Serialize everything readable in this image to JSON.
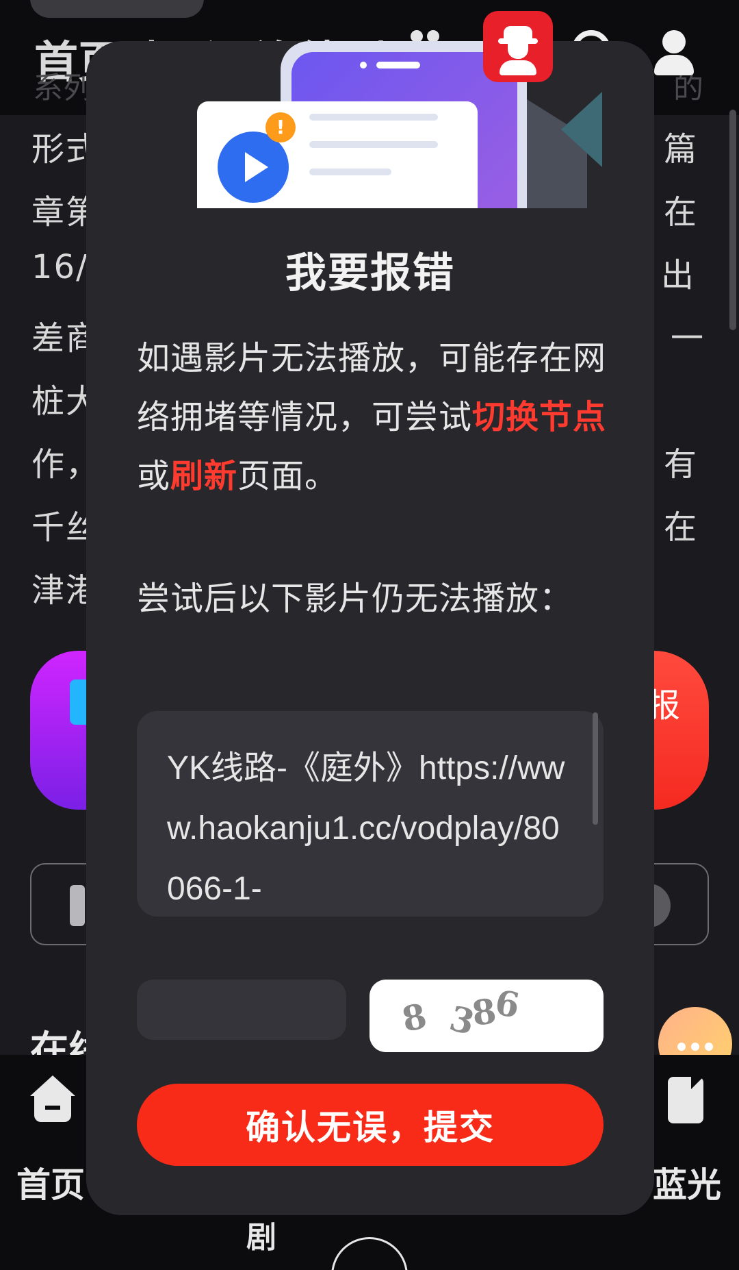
{
  "background": {
    "nav_tabs": [
      "首页",
      "电影",
      "连续剧"
    ],
    "subtitle_left": "系列",
    "subtitle_right": "的",
    "article_lines_left": [
      "形式",
      "章第",
      "16/",
      "差商",
      "桩大",
      "作，",
      "千丝",
      "津港"
    ],
    "article_lines_right": [
      "篇",
      "在",
      "出",
      "一",
      "",
      "有",
      "在",
      ""
    ],
    "red_button_label": "报",
    "section_title": "在线",
    "bottom_nav": {
      "home_label": "首页",
      "series_label": "剧",
      "bluray_label": "蓝光"
    }
  },
  "modal": {
    "alert_mark": "!",
    "title": "我要报错",
    "desc_line1": "如遇影片无法播放，可能存在网络拥堵等情况，可尝试",
    "desc_hl1": "切换节点",
    "desc_mid": "或",
    "desc_hl2": "刷新",
    "desc_end": "页面。",
    "desc2": "尝试后以下影片仍无法播放：",
    "info_text": "YK线路-《庭外》https://www.haokanju1.cc/vodplay/80066-1-",
    "code_input": {
      "value": "",
      "placeholder": ""
    },
    "captcha_chars": [
      "8",
      "3",
      "8",
      "6"
    ],
    "submit_label": "确认无误，提交"
  },
  "colors": {
    "accent": "#f82a18",
    "highlight": "#ff3b30",
    "modal_bg": "#28282c",
    "page_bg": "#1b1b1f"
  }
}
